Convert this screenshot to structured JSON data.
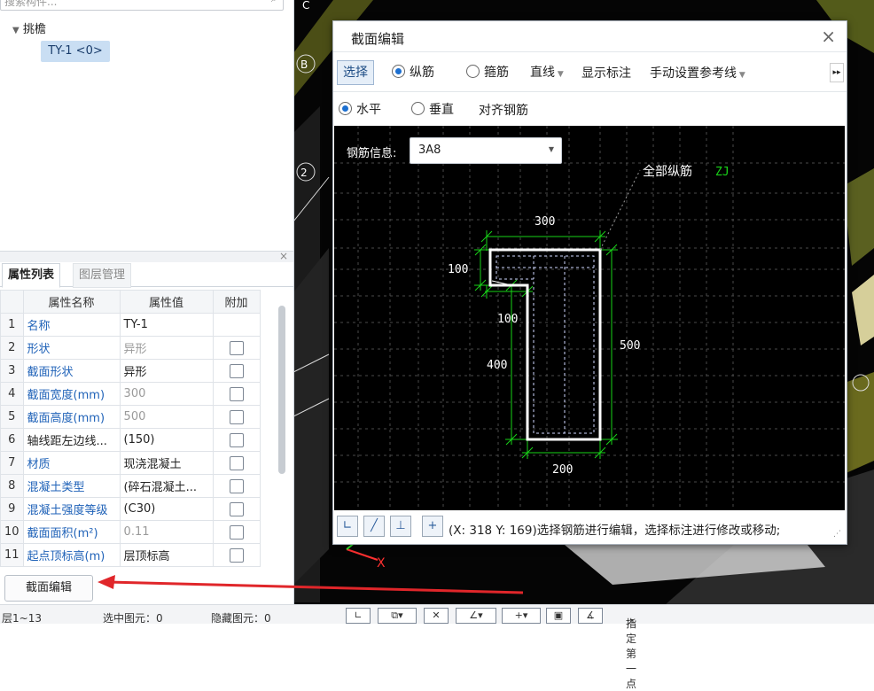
{
  "left_panel": {
    "search_placeholder": "搜索构件...",
    "tree_root": "挑檐",
    "tree_item": "TY-1 <0>",
    "tabs": [
      "属性列表",
      "图层管理"
    ],
    "table_headers": [
      "",
      "属性名称",
      "属性值",
      "附加"
    ],
    "rows": [
      {
        "no": "1",
        "name": "名称",
        "value": "TY-1",
        "checkbox": false,
        "value_gray": false
      },
      {
        "no": "2",
        "name": "形状",
        "value": "异形",
        "checkbox": true,
        "value_gray": true
      },
      {
        "no": "3",
        "name": "截面形状",
        "value": "异形",
        "checkbox": true,
        "value_gray": false
      },
      {
        "no": "4",
        "name": "截面宽度(mm)",
        "value": "300",
        "checkbox": true,
        "value_gray": true
      },
      {
        "no": "5",
        "name": "截面高度(mm)",
        "value": "500",
        "checkbox": true,
        "value_gray": true
      },
      {
        "no": "6",
        "name": "轴线距左边线...",
        "value": "(150)",
        "checkbox": true,
        "value_gray": false,
        "name_black": true
      },
      {
        "no": "7",
        "name": "材质",
        "value": "现浇混凝土",
        "checkbox": true,
        "value_gray": false
      },
      {
        "no": "8",
        "name": "混凝土类型",
        "value": "(碎石混凝土...",
        "checkbox": true,
        "value_gray": false
      },
      {
        "no": "9",
        "name": "混凝土强度等级",
        "value": "(C30)",
        "checkbox": true,
        "value_gray": false
      },
      {
        "no": "10",
        "name": "截面面积(m²)",
        "value": "0.11",
        "checkbox": true,
        "value_gray": true
      },
      {
        "no": "11",
        "name": "起点顶标高(m)",
        "value": "层顶标高",
        "checkbox": true,
        "value_gray": false
      }
    ],
    "section_edit_button": "截面编辑"
  },
  "status_bar": {
    "floor": "层1~13",
    "selected": "选中图元：0",
    "hidden": "隐藏图元：0",
    "prompt": "指定第一点"
  },
  "dialog": {
    "title": "截面编辑",
    "toolbar1": {
      "select": "选择",
      "longitudinal": "纵筋",
      "stirrup": "箍筋",
      "line_mode": "直线",
      "show_dim": "显示标注",
      "manual_ref": "手动设置参考线",
      "more": "▸▸"
    },
    "toolbar2": {
      "horizontal": "水平",
      "vertical": "垂直",
      "align": "对齐钢筋"
    },
    "canvas": {
      "rebar_info_label": "钢筋信息:",
      "rebar_info_value": "3A8",
      "all_longitudinal_label": "全部纵筋",
      "zj_label": "ZJ",
      "dims": {
        "top": "300",
        "left_top": "100",
        "step": "100",
        "left_mid": "400",
        "right": "500",
        "bottom": "200"
      }
    },
    "hint": "(X: 318 Y: 169)选择钢筋进行编辑，选择标注进行修改或移动;"
  },
  "colors": {
    "accent": "#1c6fd0",
    "dim_green": "#19d419",
    "annotation_red": "#e0262a"
  }
}
